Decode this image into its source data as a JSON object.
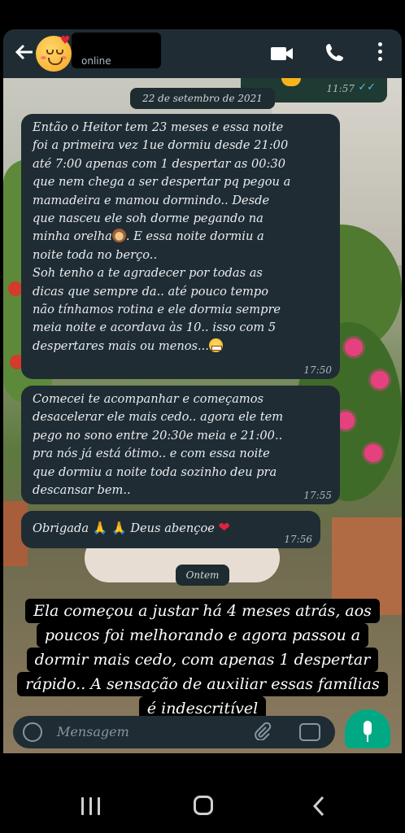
{
  "header": {
    "contact_status": "online",
    "back_icon": "arrow-left-icon",
    "video_icon": "video-call-icon",
    "call_icon": "phone-icon",
    "menu_icon": "more-vert-icon"
  },
  "top_partial_message": {
    "time": "11:57",
    "ticks": "✓✓"
  },
  "date_chips": [
    "22 de setembro de 2021",
    "Ontem"
  ],
  "messages": [
    {
      "lines": [
        "Então o Heitor tem 23 meses e essa noite",
        "foi a primeira vez 1ue dormiu desde 21:00",
        "até 7:00 apenas com 1 despertar as 00:30",
        "que nem chega a ser despertar pq pegou a",
        "mamadeira e mamou dormindo.. Desde",
        "que nasceu ele soh dorme pegando na",
        "minha orelha",
        ". E essa noite dormiu a",
        "noite toda no berço..",
        "Soh tenho a te agradecer por todas as",
        "dicas que sempre da.. até pouco tempo",
        "não tínhamos rotina e ele dormia sempre",
        "meia noite e acordava às 10.. isso com 5",
        "despertares mais ou menos..."
      ],
      "time": "17:50"
    },
    {
      "lines": [
        "Comecei te acompanhar e começamos",
        "desacelerar ele mais cedo.. agora ele tem",
        "pego no sono entre 20:30e meia e 21:00..",
        "pra nós já está ótimo..  e com essa noite",
        "que dormiu a noite toda sozinho deu pra",
        "descansar bem.."
      ],
      "time": "17:55"
    },
    {
      "lines": [
        "Obrigada",
        "Deus abençoe"
      ],
      "emoji_hands": "🙏",
      "emoji_heart": "❤",
      "time": "17:56"
    }
  ],
  "caption": {
    "lines": [
      "Ela começou a justar há 4 meses atrás, aos",
      "poucos foi melhorando e agora passou a",
      "dormir mais cedo, com apenas 1 despertar",
      "rápido.. A sensação de auxiliar essas famílias",
      "é indescritível"
    ]
  },
  "input": {
    "placeholder": "Mensagem"
  },
  "colors": {
    "bubble": "#202c33",
    "header": "#1f2c33",
    "accent": "#00a884",
    "ticks": "#53bdeb"
  }
}
